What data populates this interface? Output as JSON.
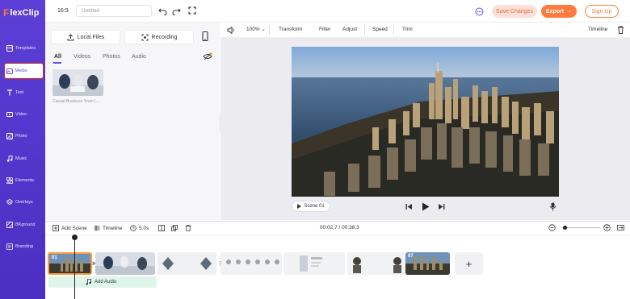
{
  "app": {
    "logo_prefix": "F",
    "logo_rest": "lexClip"
  },
  "sidebar": {
    "items": [
      {
        "label": "Templates",
        "icon": "templates-icon"
      },
      {
        "label": "Media",
        "icon": "media-icon"
      },
      {
        "label": "Text",
        "icon": "text-icon"
      },
      {
        "label": "Video",
        "icon": "video-icon"
      },
      {
        "label": "Photo",
        "icon": "photo-icon"
      },
      {
        "label": "Music",
        "icon": "music-icon"
      },
      {
        "label": "Elements",
        "icon": "elements-icon"
      },
      {
        "label": "Overlays",
        "icon": "overlays-icon"
      },
      {
        "label": "BKground",
        "icon": "background-icon"
      },
      {
        "label": "Branding",
        "icon": "branding-icon"
      }
    ]
  },
  "topbar": {
    "aspect_ratio": "16:9",
    "title_placeholder": "Untitled",
    "save_label": "Save Changes",
    "export_label": "Export",
    "signup_label": "Sign Up"
  },
  "panel": {
    "local_files_label": "Local Files",
    "recording_label": "Recording",
    "filter_tabs": [
      "All",
      "Videos",
      "Photos",
      "Audio"
    ],
    "active_filter": "All",
    "thumb_caption": "Casual Business Team l..."
  },
  "toolbar": {
    "zoom": "100%",
    "tools": [
      "Transform",
      "Filter",
      "Adjust",
      "Speed",
      "Trim"
    ],
    "timeline_label": "Timeline"
  },
  "preview": {
    "scene_label": "Scene 01"
  },
  "timeline": {
    "add_scene_label": "Add Scene",
    "timeline_label": "Timeline",
    "duration": "5.0s",
    "time_display": "00:02.7 / 00:38.3",
    "add_audio_label": "Add Audio",
    "scene_numbers": [
      "01",
      "07"
    ]
  },
  "colors": {
    "sidebar": "#5b3fd6",
    "accent": "#ff7a3d",
    "highlight": "#d22222",
    "audio_track": "#dff5ea"
  }
}
